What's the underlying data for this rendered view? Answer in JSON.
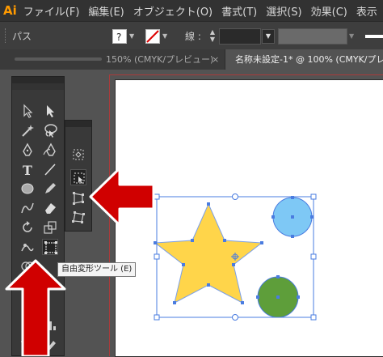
{
  "app": {
    "logo": "Ai"
  },
  "menu": [
    "ファイル(F)",
    "編集(E)",
    "オブジェクト(O)",
    "書式(T)",
    "選択(S)",
    "効果(C)",
    "表示"
  ],
  "control_bar": {
    "object_label": "パス",
    "fill_icon": "unknown-fill-icon",
    "stroke_icon": "none-stroke-icon",
    "stroke_label": "線 :"
  },
  "tabs": [
    {
      "label": "150% (CMYK/プレビュー)",
      "close": "×"
    },
    {
      "label": "名称未設定-1* @ 100% (CMYK/プレビ"
    }
  ],
  "tooltip": "自由変形ツール (E)",
  "colors": {
    "star": "#FFD54A",
    "light_blue_circle": "#7EC8F5",
    "green_circle": "#5E9E3A",
    "selection": "#4A7CE0",
    "arrow": "#D00000"
  },
  "tools": [
    "selection-tool-icon",
    "direct-selection-tool-icon",
    "magic-wand-tool-icon",
    "lasso-tool-icon",
    "pen-tool-icon",
    "curvature-tool-icon",
    "type-tool-icon",
    "line-segment-tool-icon",
    "ellipse-tool-icon",
    "pencil-tool-icon",
    "eraser-tool-icon",
    "rotate-tool-icon",
    "scale-tool-icon",
    "puppet-warp-tool-icon",
    "free-transform-tool-icon",
    "shape-builder-tool-icon",
    "eyedropper-tool-icon",
    "graph-tool-icon",
    "artboard-tool-icon",
    "slice-tool-icon"
  ],
  "flyout_tools": [
    "constrain-icon",
    "free-transform-icon",
    "perspective-distort-icon",
    "free-distort-icon"
  ]
}
